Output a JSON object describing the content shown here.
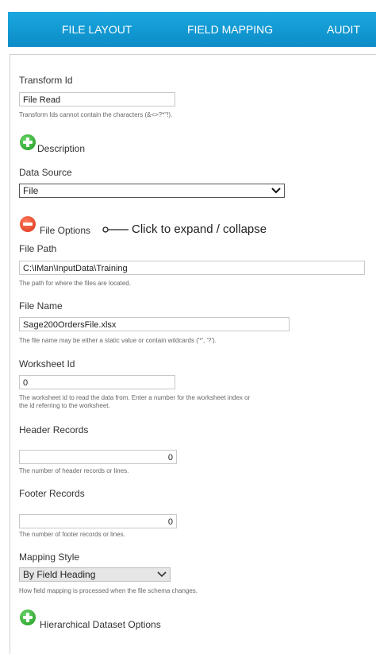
{
  "tabs": [
    {
      "label": "FILE LAYOUT"
    },
    {
      "label": "FIELD MAPPING"
    },
    {
      "label": "AUDIT"
    }
  ],
  "transform_id": {
    "label": "Transform Id",
    "value": "File Read",
    "help": "Transform Ids cannot contain the characters (&<>?*\"!)."
  },
  "description_toggle": {
    "label": "Description",
    "icon": "plus-circle-icon"
  },
  "data_source": {
    "label": "Data Source",
    "selected": "File"
  },
  "file_options_toggle": {
    "label": "File Options",
    "icon": "minus-circle-icon"
  },
  "annotation": {
    "text": "Click to expand / collapse"
  },
  "file_path": {
    "label": "File Path",
    "value": "C:\\IMan\\InputData\\Training",
    "help": "The path for where the files are located."
  },
  "file_name": {
    "label": "File Name",
    "value": "Sage200OrdersFile.xlsx",
    "help": "The file name may be either a static value or contain wildcards ('*', '?')."
  },
  "worksheet_id": {
    "label": "Worksheet Id",
    "value": "0",
    "help_line1": "The worksheet id to read the data from. Enter a number for the worksheet index or",
    "help_line2": "the id referring to the worksheet."
  },
  "header_records": {
    "label": "Header Records",
    "value": "0",
    "help": "The number of header records or lines."
  },
  "footer_records": {
    "label": "Footer Records",
    "value": "0",
    "help": "The number of footer records or lines."
  },
  "mapping_style": {
    "label": "Mapping Style",
    "selected": "By Field Heading",
    "help": "How field mapping is processed when the file schema changes."
  },
  "hierarchical_toggle": {
    "label": "Hierarchical Dataset Options",
    "icon": "plus-circle-icon"
  },
  "colors": {
    "tab_bar": "#129bd5",
    "add": "#2da82d",
    "remove": "#e2472b"
  }
}
